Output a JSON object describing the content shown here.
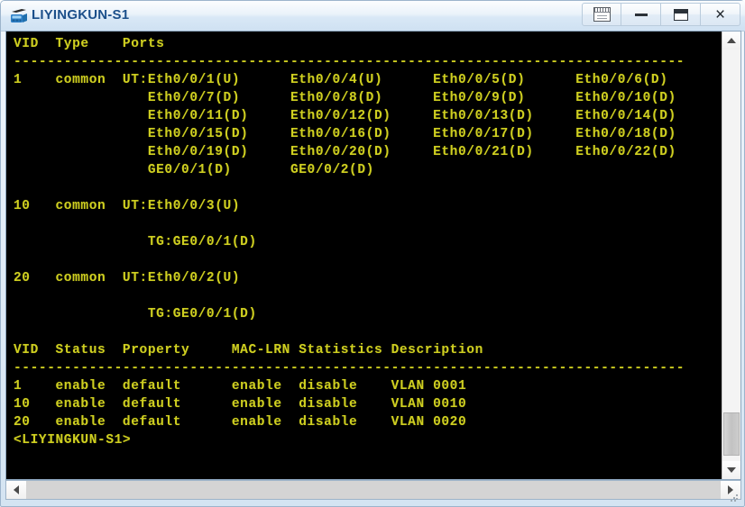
{
  "window": {
    "title": "LIYINGKUN-S1",
    "icon": "switch-device-icon",
    "accent_color": "#1b4f8a",
    "terminal_background": "#000000",
    "terminal_foreground": "#cfcf20",
    "controls": [
      {
        "name": "restore-document-button",
        "label": "",
        "icon": "document-restore-icon"
      },
      {
        "name": "minimize-button",
        "label": "",
        "icon": "minimize-icon"
      },
      {
        "name": "maximize-button",
        "label": "",
        "icon": "maximize-icon"
      },
      {
        "name": "close-button",
        "label": "×",
        "icon": "close-icon"
      }
    ]
  },
  "terminal": {
    "lines": [
      "VID  Type    Ports",
      "--------------------------------------------------------------------------------",
      "1    common  UT:Eth0/0/1(U)      Eth0/0/4(U)      Eth0/0/5(D)      Eth0/0/6(D)",
      "                Eth0/0/7(D)      Eth0/0/8(D)      Eth0/0/9(D)      Eth0/0/10(D)",
      "                Eth0/0/11(D)     Eth0/0/12(D)     Eth0/0/13(D)     Eth0/0/14(D)",
      "                Eth0/0/15(D)     Eth0/0/16(D)     Eth0/0/17(D)     Eth0/0/18(D)",
      "                Eth0/0/19(D)     Eth0/0/20(D)     Eth0/0/21(D)     Eth0/0/22(D)",
      "                GE0/0/1(D)       GE0/0/2(D)",
      "",
      "10   common  UT:Eth0/0/3(U)",
      "",
      "                TG:GE0/0/1(D)",
      "",
      "20   common  UT:Eth0/0/2(U)",
      "",
      "                TG:GE0/0/1(D)",
      "",
      "VID  Status  Property     MAC-LRN Statistics Description",
      "--------------------------------------------------------------------------------",
      "1    enable  default      enable  disable    VLAN 0001",
      "10   enable  default      enable  disable    VLAN 0010",
      "20   enable  default      enable  disable    VLAN 0020",
      "<LIYINGKUN-S1>"
    ],
    "vlan_port_table": {
      "headers": [
        "VID",
        "Type",
        "Ports"
      ],
      "rows": [
        {
          "vid": "1",
          "type": "common",
          "ports": [
            [
              "UT:Eth0/0/1(U)",
              "Eth0/0/4(U)",
              "Eth0/0/5(D)",
              "Eth0/0/6(D)"
            ],
            [
              "Eth0/0/7(D)",
              "Eth0/0/8(D)",
              "Eth0/0/9(D)",
              "Eth0/0/10(D)"
            ],
            [
              "Eth0/0/11(D)",
              "Eth0/0/12(D)",
              "Eth0/0/13(D)",
              "Eth0/0/14(D)"
            ],
            [
              "Eth0/0/15(D)",
              "Eth0/0/16(D)",
              "Eth0/0/17(D)",
              "Eth0/0/18(D)"
            ],
            [
              "Eth0/0/19(D)",
              "Eth0/0/20(D)",
              "Eth0/0/21(D)",
              "Eth0/0/22(D)"
            ],
            [
              "GE0/0/1(D)",
              "GE0/0/2(D)"
            ]
          ]
        },
        {
          "vid": "10",
          "type": "common",
          "ports": [
            [
              "UT:Eth0/0/3(U)"
            ],
            [],
            [
              "TG:GE0/0/1(D)"
            ]
          ]
        },
        {
          "vid": "20",
          "type": "common",
          "ports": [
            [
              "UT:Eth0/0/2(U)"
            ],
            [],
            [
              "TG:GE0/0/1(D)"
            ]
          ]
        }
      ]
    },
    "vlan_status_table": {
      "headers": [
        "VID",
        "Status",
        "Property",
        "MAC-LRN",
        "Statistics",
        "Description"
      ],
      "rows": [
        [
          "1",
          "enable",
          "default",
          "enable",
          "disable",
          "VLAN 0001"
        ],
        [
          "10",
          "enable",
          "default",
          "enable",
          "disable",
          "VLAN 0010"
        ],
        [
          "20",
          "enable",
          "default",
          "enable",
          "disable",
          "VLAN 0020"
        ]
      ]
    },
    "prompt": "<LIYINGKUN-S1>"
  },
  "scrollbars": {
    "vertical": {
      "up_arrow": "▲",
      "down_arrow": "▼"
    },
    "horizontal": {
      "left_arrow": "◀",
      "right_arrow": "▶"
    }
  }
}
